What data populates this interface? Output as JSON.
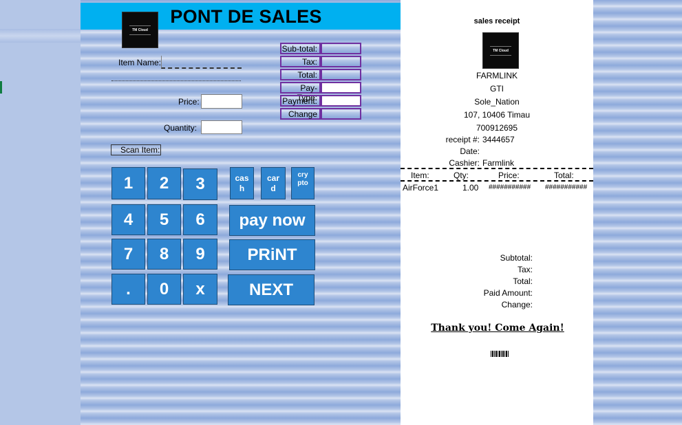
{
  "pos": {
    "title": "PONT DE SALES",
    "logo_text": "TM Cloud",
    "item_name_label": "Item Name:",
    "price_label": "Price:",
    "quantity_label": "Quantity:",
    "scan_item_label": "Scan Item:",
    "totals": [
      "Sub-total:",
      "Tax:",
      "Total:",
      "Pay-Type:",
      "Payment:",
      "Change"
    ],
    "keys": {
      "k1": "1",
      "k2": "2",
      "k3": "3",
      "k4": "4",
      "k5": "5",
      "k6": "6",
      "k7": "7",
      "k8": "8",
      "k9": "9",
      "dot": ".",
      "k0": "0",
      "x": "x"
    },
    "cash": [
      "cas",
      "h"
    ],
    "card": [
      "car",
      "d"
    ],
    "crypto": [
      "cry",
      "pto"
    ],
    "pay_now": "pay now",
    "print": "PRiNT",
    "next": "NEXT"
  },
  "receipt": {
    "title": "sales receipt",
    "logo_text": "TM Cloud",
    "company": "FARMLINK",
    "line2": "GTI",
    "line3": "Sole_Nation",
    "address": "107, 10406 Timau",
    "phone": "700912695",
    "receipt_no_label": "receipt #:",
    "receipt_no": "3444657",
    "date_label": "Date:",
    "cashier_label": "Cashier:",
    "cashier": "Farmlink",
    "columns": [
      "Item:",
      "Qty:",
      "Price:",
      "Total:"
    ],
    "row": {
      "item": "AirForce1",
      "qty": "1.00",
      "price": "###########",
      "total": "###########"
    },
    "summary": [
      "Subtotal:",
      "Tax:",
      "Total:",
      "Paid Amount:",
      "Change:"
    ],
    "thanks": "Thank you! Come Again!"
  },
  "colors": {
    "title_bar": "#00b0f0",
    "key_blue": "#2e85cf",
    "totals_border": "#7030a0",
    "sheet_blue": "#b4c6e7"
  }
}
